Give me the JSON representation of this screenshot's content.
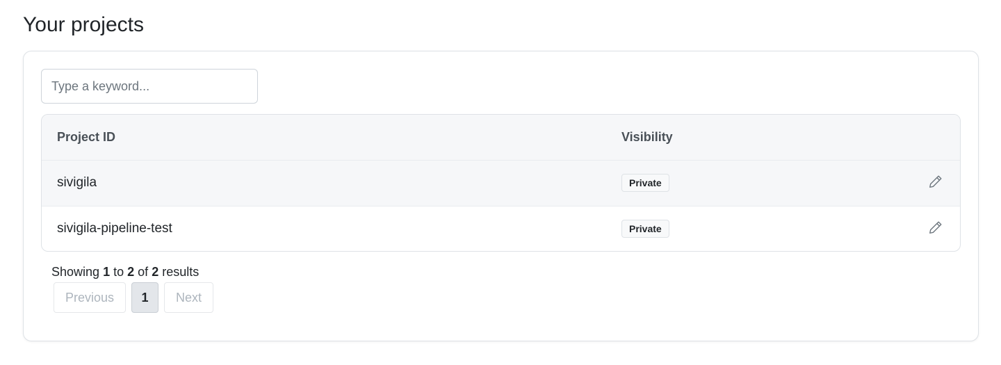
{
  "page": {
    "title": "Your projects"
  },
  "search": {
    "placeholder": "Type a keyword...",
    "value": ""
  },
  "table": {
    "headers": {
      "project_id": "Project ID",
      "visibility": "Visibility"
    },
    "rows": [
      {
        "project_id": "sivigila",
        "visibility": "Private",
        "action_icon": "pencil-icon"
      },
      {
        "project_id": "sivigila-pipeline-test",
        "visibility": "Private",
        "action_icon": "pencil-icon"
      }
    ]
  },
  "pagination": {
    "prefix": "Showing",
    "from": "1",
    "to_word": "to",
    "to": "2",
    "of_word": "of",
    "total": "2",
    "suffix": "results",
    "previous_label": "Previous",
    "current_page": "1",
    "next_label": "Next"
  },
  "colors": {
    "header_bg": "#f6f7f9",
    "border": "#dee2e6",
    "muted_text": "#adb5bd",
    "active_page_bg": "#e3e6ea"
  }
}
